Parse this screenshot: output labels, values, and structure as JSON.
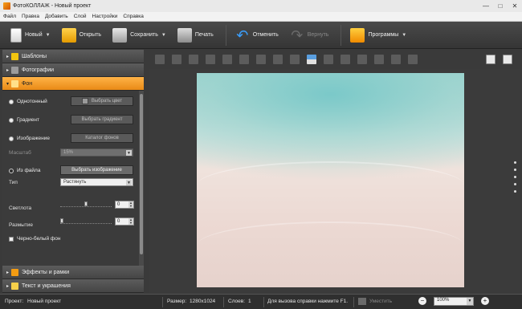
{
  "window": {
    "title": "ФотоКОЛЛАЖ - Новый проект",
    "controls": [
      "—",
      "□",
      "✕"
    ]
  },
  "menu": [
    "Файл",
    "Правка",
    "Добавить",
    "Слой",
    "Настройки",
    "Справка"
  ],
  "toolbar": {
    "new": "Новый",
    "open": "Открыть",
    "save": "Сохранить",
    "print": "Печать",
    "undo": "Отменить",
    "redo": "Вернуть",
    "programs": "Программы"
  },
  "panel": {
    "templates": "Шаблоны",
    "photos": "Фотографии",
    "background": "Фон",
    "effects": "Эффекты и рамки",
    "text": "Текст и украшения"
  },
  "background": {
    "solid": "Однотонный",
    "choose_color": "Выбрать цвет",
    "gradient": "Градиент",
    "choose_gradient": "Выбрать градиент",
    "image": "Изображение",
    "catalog": "Каталог фонов",
    "scale_label": "Масштаб",
    "scale_value": "15%",
    "from_file": "Из файла",
    "choose_image": "Выбрать изображение",
    "type_label": "Тип",
    "type_value": "Растянуть",
    "brightness_label": "Светлота",
    "brightness_value": "0",
    "blur_label": "Размытие",
    "blur_value": "0",
    "bw_label": "Черно-белый фон",
    "selected_mode": "from_file"
  },
  "status": {
    "project_label": "Проект:",
    "project_name": "Новый проект",
    "size_label": "Размер:",
    "size_value": "1280x1024",
    "layers_label": "Слоев:",
    "layers_value": "1",
    "help": "Для вызова справки нажмите F1.",
    "reduce": "Уместить",
    "zoom": "100%"
  },
  "colors": {
    "accent": "#f0a030",
    "panel": "#3d3d3d",
    "toolbar": "#404040"
  }
}
